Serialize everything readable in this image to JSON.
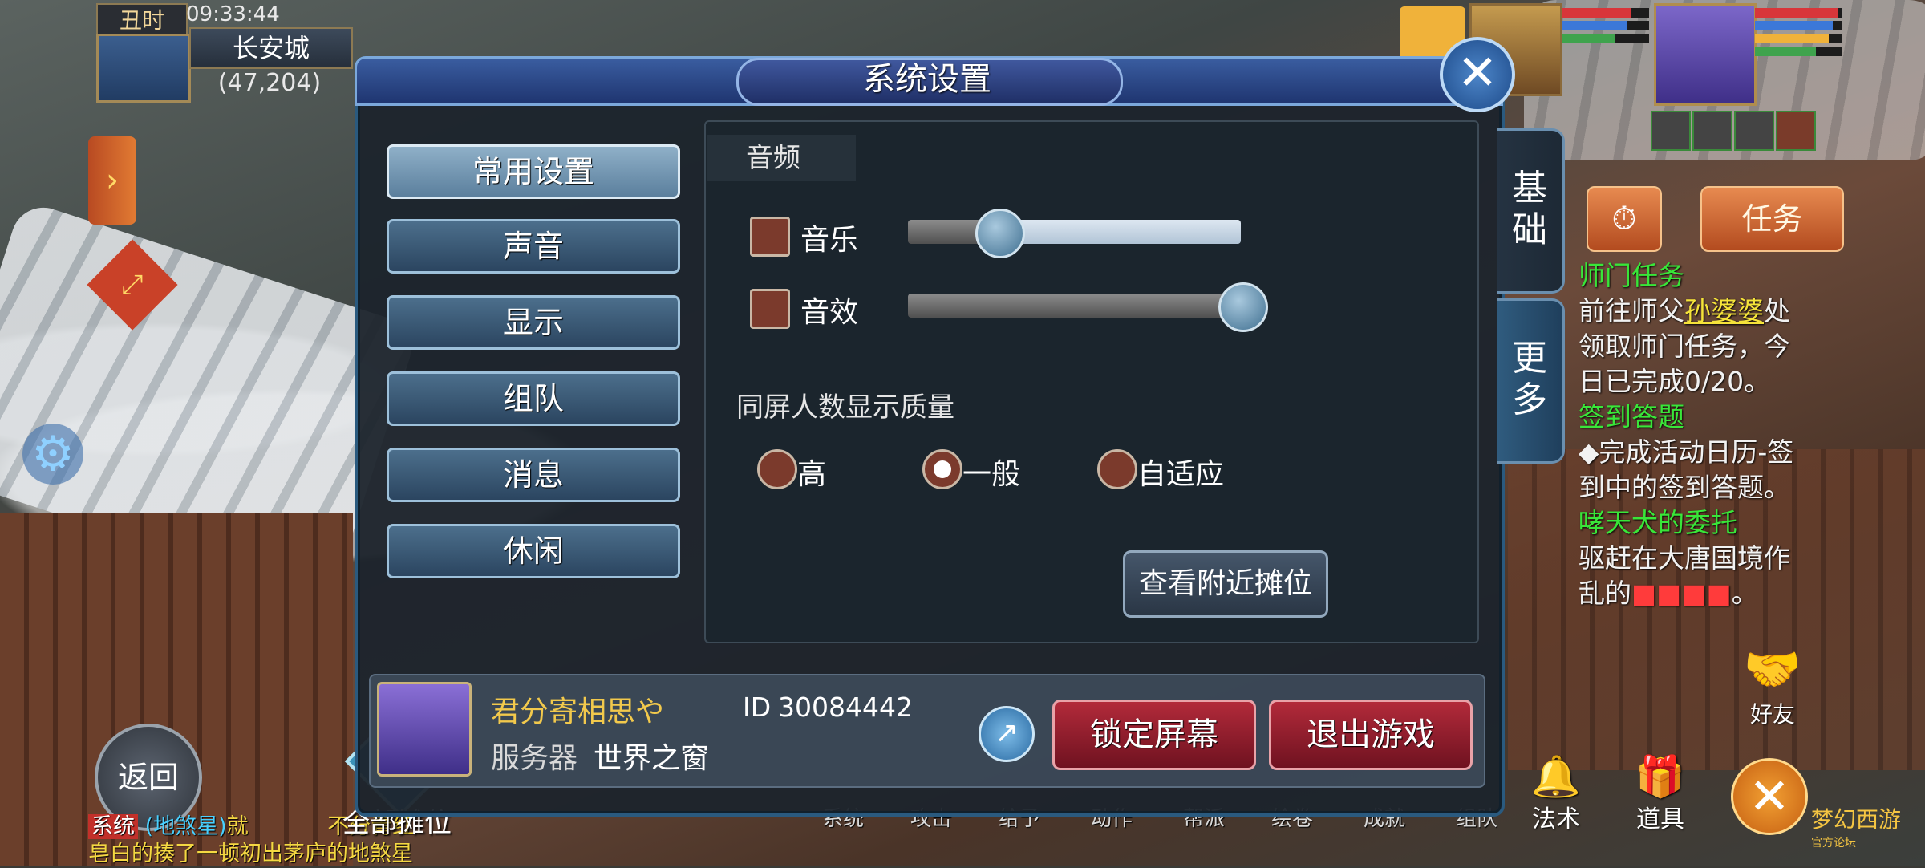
{
  "hud": {
    "shichen": "丑时",
    "clock": "09:33:44",
    "map_name": "长安城",
    "map_coords": "(47,204)"
  },
  "task_button": "任务",
  "quests": [
    {
      "title": "师门任务",
      "lines": [
        "前往师父",
        "孙婆婆",
        "处",
        "领取师门任务，今",
        "日已完成0/20。"
      ]
    },
    {
      "title": "签到答题",
      "lines": [
        "◆完成活动日历-签",
        "到中的签到答题。"
      ]
    },
    {
      "title": "哮天犬的委托",
      "lines": [
        "驱赶在大唐国境作",
        "乱的",
        "",
        "。"
      ]
    }
  ],
  "friend_label": "好友",
  "bottom_buttons": [
    {
      "label": "法术",
      "icon": "bell-icon"
    },
    {
      "label": "道具",
      "icon": "chest-icon"
    }
  ],
  "logo": {
    "line1": "梦幻西游",
    "line2": "官方论坛"
  },
  "back_label": "返回",
  "stall_label": "全部摊位",
  "chat": {
    "tag": "系统",
    "name": "(地煞星)",
    "line1_mid": "就",
    "line1_end": "不分青红",
    "line2": "皂白的揍了一顿初出茅庐的地煞星"
  },
  "menu_strip": [
    "系统",
    "攻击",
    "给予",
    "动作",
    "帮派",
    "绘卷",
    "成就",
    "组队"
  ],
  "dialog": {
    "title": "系统设置",
    "tabs": {
      "basic": [
        "基",
        "础"
      ],
      "more": [
        "更",
        "多"
      ]
    },
    "categories": [
      "常用设置",
      "声音",
      "显示",
      "组队",
      "消息",
      "休闲"
    ],
    "active_category": 0,
    "audio_header": "音频",
    "music_label": "音乐",
    "music_level": 0.27,
    "sfx_label": "音效",
    "sfx_level": 1.0,
    "quality_title": "同屏人数显示质量",
    "quality_options": [
      "高",
      "一般",
      "自适应"
    ],
    "quality_selected": 1,
    "nearby_button": "查看附近摊位"
  },
  "player": {
    "name": "君分寄相思や",
    "id_label": "ID",
    "id": "30084442",
    "server_label": "服务器",
    "server_name": "世界之窗",
    "lock_button": "锁定屏幕",
    "exit_button": "退出游戏"
  },
  "colors": {
    "accent_blue": "#2a5a7f",
    "danger_red": "#b22a3a",
    "quest_green": "#39e639",
    "quest_highlight": "#f5e33a"
  }
}
